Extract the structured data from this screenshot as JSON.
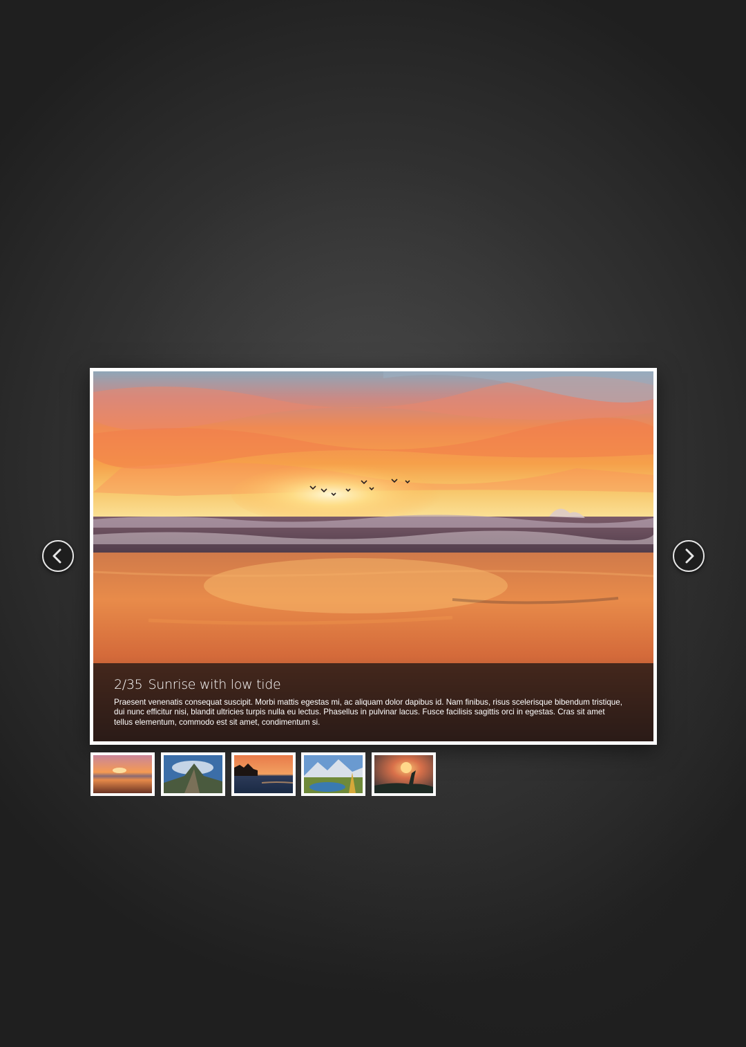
{
  "gallery": {
    "current": {
      "counter": "2/35",
      "title": "Sunrise with low tide",
      "description": "Praesent venenatis consequat suscipit. Morbi mattis egestas mi, ac aliquam dolor dapibus id. Nam finibus, risus scelerisque bibendum tristique, dui nunc efficitur nisi, blandit ultricies turpis nulla eu lectus. Phasellus in pulvinar lacus. Fusce facilisis sagittis orci in egestas. Cras sit amet tellus elementum, commodo est sit amet, condimentum si."
    },
    "nav": {
      "prev_icon": "chevron-left-icon",
      "next_icon": "chevron-right-icon"
    },
    "thumbnails": [
      {
        "subject": "sunset-beach",
        "selected": true
      },
      {
        "subject": "mountain-ridge",
        "selected": false
      },
      {
        "subject": "palm-island-sunset",
        "selected": false
      },
      {
        "subject": "alpine-lake",
        "selected": false
      },
      {
        "subject": "silhouette-sunset",
        "selected": false
      }
    ]
  },
  "colors": {
    "frame_border": "#ffffff",
    "caption_background": "#1e1614",
    "page_background": "#2c2c2c"
  }
}
